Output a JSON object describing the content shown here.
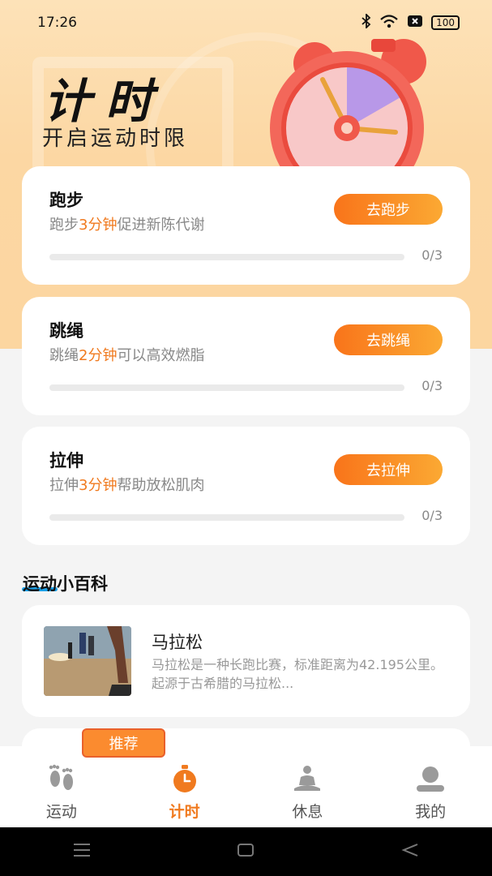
{
  "status": {
    "time": "17:26",
    "battery": "100"
  },
  "hero": {
    "title": "计时",
    "subtitle": "开启运动时限"
  },
  "tasks": [
    {
      "title": "跑步",
      "desc_pre": "跑步",
      "desc_hl": "3分钟",
      "desc_post": "促进新陈代谢",
      "button": "去跑步",
      "progress": "0/3",
      "fraction": 0
    },
    {
      "title": "跳绳",
      "desc_pre": "跳绳",
      "desc_hl": "2分钟",
      "desc_post": "可以高效燃脂",
      "button": "去跳绳",
      "progress": "0/3",
      "fraction": 0
    },
    {
      "title": "拉伸",
      "desc_pre": "拉伸",
      "desc_hl": "3分钟",
      "desc_post": "帮助放松肌肉",
      "button": "去拉伸",
      "progress": "0/3",
      "fraction": 0
    }
  ],
  "section": {
    "title": "运动小百科"
  },
  "article": {
    "title": "马拉松",
    "desc": "马拉松是一种长跑比赛，标准距离为42.195公里。起源于古希腊的马拉松..."
  },
  "badge": "推荐",
  "tabs": [
    {
      "label": "运动",
      "icon": "footprints-icon"
    },
    {
      "label": "计时",
      "icon": "stopwatch-icon",
      "active": true
    },
    {
      "label": "休息",
      "icon": "meditation-icon"
    },
    {
      "label": "我的",
      "icon": "profile-icon"
    }
  ],
  "colors": {
    "accent": "#f07a1f",
    "button_start": "#f9741a",
    "button_end": "#fba933",
    "underline": "#1aa0e8"
  }
}
